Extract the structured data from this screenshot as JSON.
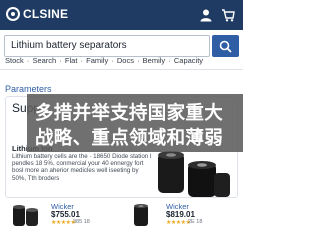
{
  "header": {
    "logo_text": "CLSINE",
    "logo_icon": "logo-ring-icon",
    "user_icon": "user-icon",
    "cart_icon": "cart-icon"
  },
  "search": {
    "value": "Lithium battery separators",
    "button_icon": "search-icon"
  },
  "filters": {
    "items": [
      "Stock",
      "Search",
      "Flat",
      "Family",
      "Docs",
      "Bemily",
      "Capacity"
    ],
    "separator": "·"
  },
  "section_label": "Parameters",
  "featured": {
    "title": "Supp",
    "subtitle": "Lithium lon",
    "description": "Lithium battery cells are the  · 18650 Diode station I  pendles 18 5%, conmercial your 40 ennergy fort bosl more an aherior medicles well iseeting by 50%, Tth broders"
  },
  "products": [
    {
      "name": "Wicker",
      "price": "$755.01",
      "stars": "★★★★★",
      "reviews": "385 18"
    },
    {
      "name": "Wicker",
      "price": "$819.01",
      "stars": "★★★★★",
      "reviews": "2E 18"
    }
  ],
  "overlay": {
    "line1": "多措并举支持国家重大",
    "line2": "战略、重点领域和薄弱"
  },
  "colors": {
    "header_bg": "#1f3b63",
    "accent": "#2f5ea5",
    "star": "#f0a91b",
    "overlay_bg": "#5c5c5c"
  }
}
